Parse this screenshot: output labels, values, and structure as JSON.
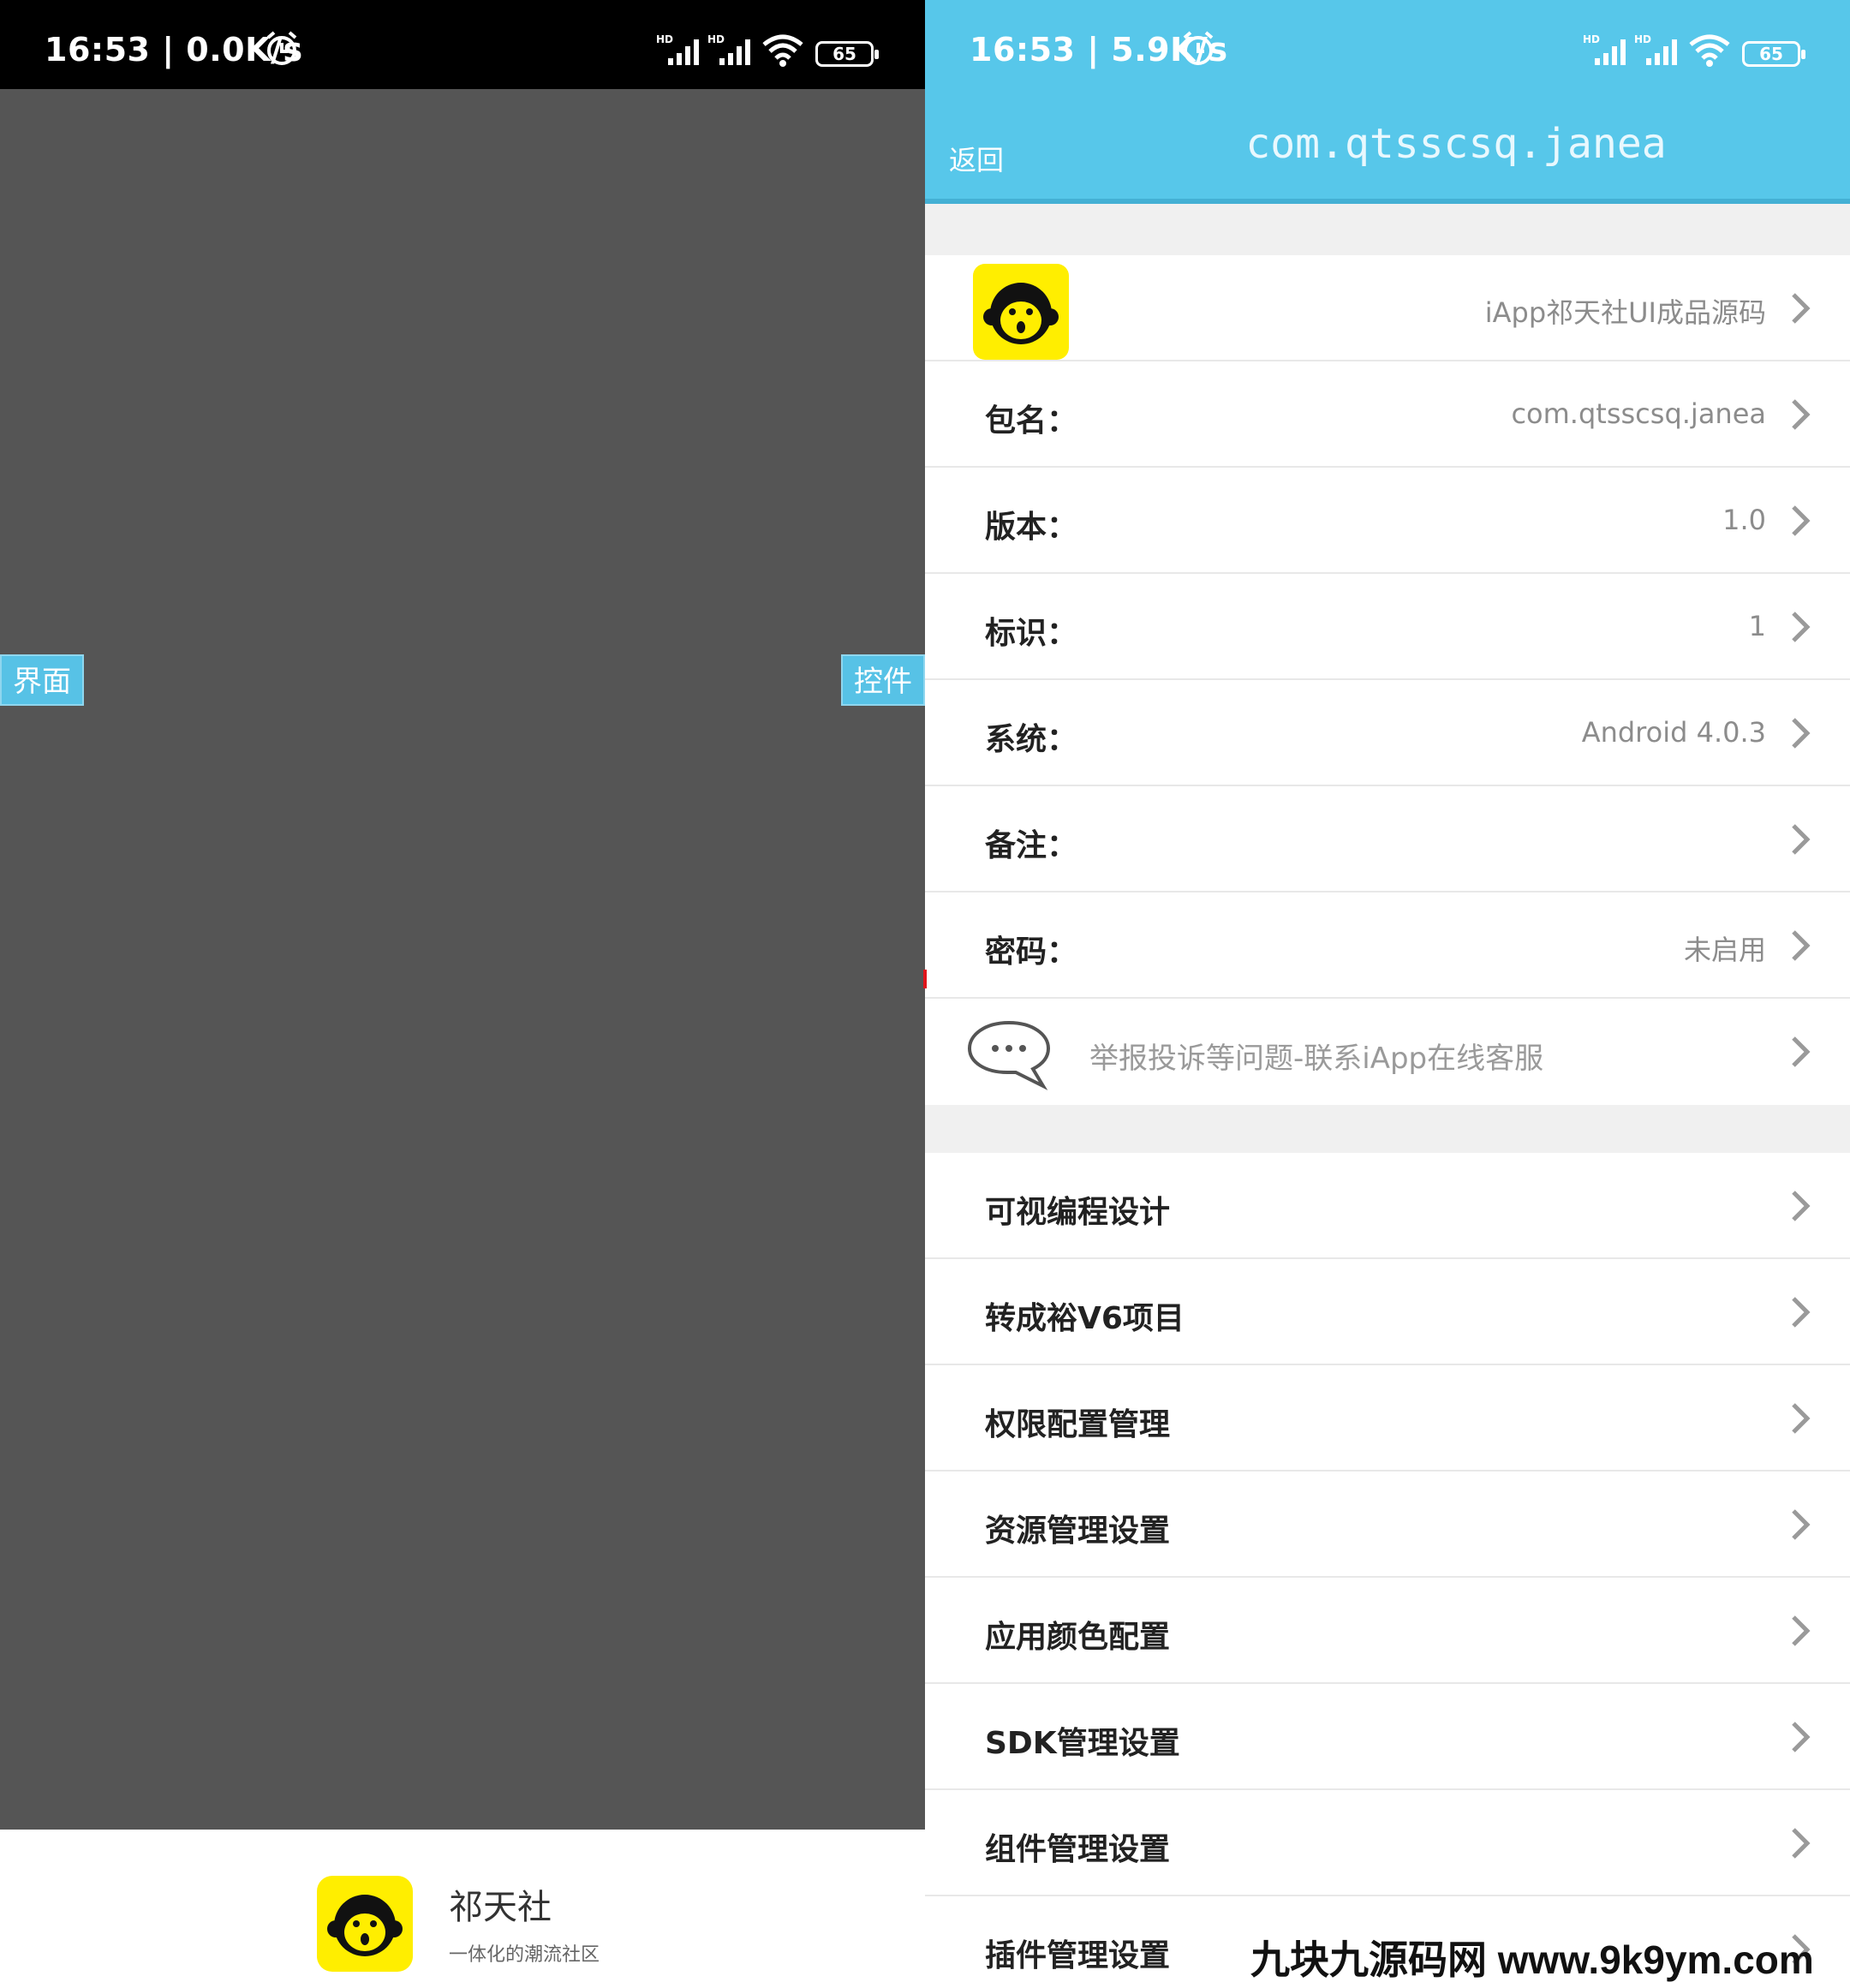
{
  "left_screen": {
    "status_bar": {
      "time_speed": "16:53 | 0.0K/s",
      "battery": "65"
    },
    "side_tabs": {
      "left": "界面",
      "right": "控件"
    },
    "splash": {
      "app_name": "祁天社",
      "slogan": "一体化的潮流社区"
    }
  },
  "right_screen": {
    "status_bar": {
      "time_speed": "16:53 | 5.9K/s",
      "battery": "65"
    },
    "header": {
      "back": "返回",
      "title": "com.qtsscsq.janea"
    },
    "info_rows": {
      "app": {
        "value": "iApp祁天社UI成品源码"
      },
      "package": {
        "label": "包名：",
        "value": "com.qtsscsq.janea"
      },
      "version": {
        "label": "版本：",
        "value": "1.0"
      },
      "id": {
        "label": "标识：",
        "value": "1"
      },
      "system": {
        "label": "系统：",
        "value": "Android 4.0.3"
      },
      "note": {
        "label": "备注：",
        "value": ""
      },
      "password": {
        "label": "密码：",
        "value": "未启用"
      },
      "report": {
        "text": "举报投诉等问题-联系iApp在线客服"
      }
    },
    "menu_rows": [
      {
        "label": "可视编程设计"
      },
      {
        "label": "转成裕V6项目"
      },
      {
        "label": "权限配置管理"
      },
      {
        "label": "资源管理设置"
      },
      {
        "label": "应用颜色配置"
      },
      {
        "label": "SDK管理设置"
      },
      {
        "label": "组件管理设置"
      },
      {
        "label": "插件管理设置"
      }
    ]
  },
  "watermark": "九块九源码网 www.9k9ym.com",
  "colors": {
    "accent": "#57c7ea",
    "canvas": "#555555",
    "logo_yellow": "#ffee00"
  },
  "icons": [
    "alarm-icon",
    "signal-icon",
    "wifi-icon",
    "battery-icon",
    "monkey-logo-icon",
    "chat-bubble-icon",
    "chevron-right-icon"
  ]
}
